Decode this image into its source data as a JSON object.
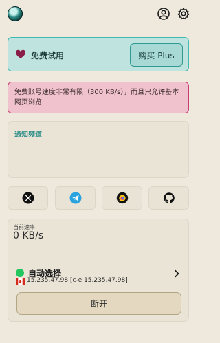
{
  "header": {
    "logo_icon": "app-logo-icon",
    "account_icon": "user-circle-icon",
    "settings_icon": "gear-icon"
  },
  "plan": {
    "title": "免费试用",
    "buy_label": "购买 Plus",
    "icon": "heart-icon",
    "accent": "#8a1e49"
  },
  "notice": {
    "text": "免费账号速度非常有限（300 KB/s），而且只允许基本网页浏览"
  },
  "channel": {
    "title": "通知频道"
  },
  "social": [
    {
      "icon": "x-icon"
    },
    {
      "icon": "telegram-icon"
    },
    {
      "icon": "chat-bubble-icon"
    },
    {
      "icon": "github-icon"
    }
  ],
  "speed": {
    "label": "当前速率",
    "value": "0 KB/s"
  },
  "connection": {
    "mode": "自动选择",
    "status_color": "#22c55e",
    "flag": "canada-flag-icon",
    "server": "15.235.47.98 [c-e 15.235.47.98]",
    "disconnect_label": "断开"
  }
}
